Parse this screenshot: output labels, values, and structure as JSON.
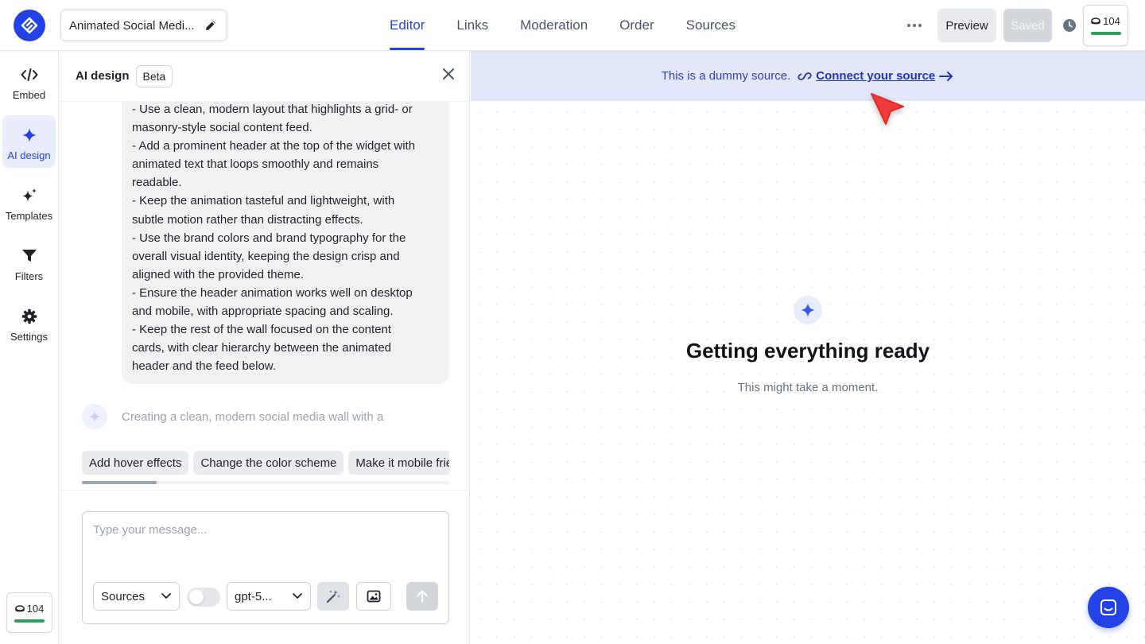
{
  "header": {
    "widget_title": "Animated Social Medi...",
    "tabs": [
      {
        "label": "Editor",
        "active": true
      },
      {
        "label": "Links"
      },
      {
        "label": "Moderation"
      },
      {
        "label": "Order"
      },
      {
        "label": "Sources"
      }
    ],
    "preview_label": "Preview",
    "saved_label": "Saved",
    "credits": "104"
  },
  "rail": {
    "items": [
      {
        "label": "Embed",
        "icon": "code-icon"
      },
      {
        "label": "AI design",
        "icon": "sparkle-icon",
        "active": true
      },
      {
        "label": "Templates",
        "icon": "sparkles-icon"
      },
      {
        "label": "Filters",
        "icon": "filter-icon"
      },
      {
        "label": "Settings",
        "icon": "gear-icon"
      }
    ],
    "credits": "104"
  },
  "panel": {
    "title": "AI design",
    "badge": "Beta",
    "message_lines": [
      "- Use a clean, modern layout that highlights a grid- or",
      "masonry-style social content feed.",
      "- Add a prominent header at the top of the widget with",
      "animated text that loops smoothly and remains",
      "readable.",
      "- Keep the animation tasteful and lightweight, with",
      "subtle motion rather than distracting effects.",
      "- Use the brand colors and brand typography for the",
      "overall visual identity, keeping the design crisp and",
      "aligned with the provided theme.",
      "- Ensure the header animation works well on desktop",
      "and mobile, with appropriate spacing and scaling.",
      "- Keep the rest of the wall focused on the content",
      "cards, with clear hierarchy between the animated",
      "header and the feed below."
    ],
    "thinking_text": "Creating a clean, modern social media wall with a",
    "suggestions": [
      "Add hover effects",
      "Change the color scheme",
      "Make it mobile friendly"
    ],
    "composer": {
      "placeholder": "Type your message...",
      "value": "",
      "source_select": "Sources",
      "model_select": "gpt-5...",
      "toggle_on": false
    }
  },
  "stage": {
    "notice_text": "This is a dummy source.",
    "notice_link": "Connect your source",
    "loading_title": "Getting everything ready",
    "loading_subtitle": "This might take a moment."
  },
  "colors": {
    "accent": "#2342e6",
    "notice_bg": "#e3e7fb",
    "credit_bar": "#2f9e58",
    "cursor": "#f03b3b"
  }
}
